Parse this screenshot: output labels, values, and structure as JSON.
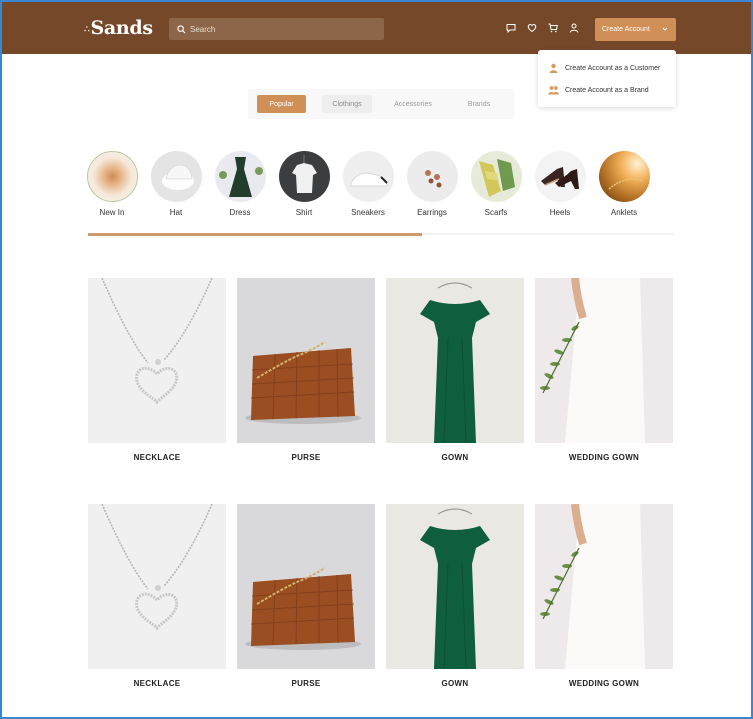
{
  "brand": {
    "name": "Sands",
    "accent": "#cf8f57",
    "header_bg": "#75482a"
  },
  "search": {
    "placeholder": "Search"
  },
  "header_icons": [
    "chat-icon",
    "heart-icon",
    "cart-icon",
    "user-icon"
  ],
  "create_account": {
    "label": "Create Account",
    "menu": [
      {
        "label": "Create Account as a Customer",
        "icon": "user-icon"
      },
      {
        "label": "Create Account as a Brand",
        "icon": "users-icon"
      }
    ]
  },
  "tabs": [
    {
      "label": "Popular",
      "active": true
    },
    {
      "label": "Clothings",
      "active": false
    },
    {
      "label": "Accessories",
      "active": false
    },
    {
      "label": "Brands",
      "active": false
    }
  ],
  "categories": [
    {
      "label": "New In"
    },
    {
      "label": "Hat"
    },
    {
      "label": "Dress"
    },
    {
      "label": "Shirt"
    },
    {
      "label": "Sneakers"
    },
    {
      "label": "Earrings"
    },
    {
      "label": "Scarfs"
    },
    {
      "label": "Heels"
    },
    {
      "label": "Anklets"
    }
  ],
  "category_scroll": {
    "progress": 0.57
  },
  "products": [
    {
      "name": "NECKLACE"
    },
    {
      "name": "PURSE"
    },
    {
      "name": "GOWN"
    },
    {
      "name": "WEDDING GOWN"
    },
    {
      "name": "NECKLACE"
    },
    {
      "name": "PURSE"
    },
    {
      "name": "GOWN"
    },
    {
      "name": "WEDDING GOWN"
    }
  ]
}
